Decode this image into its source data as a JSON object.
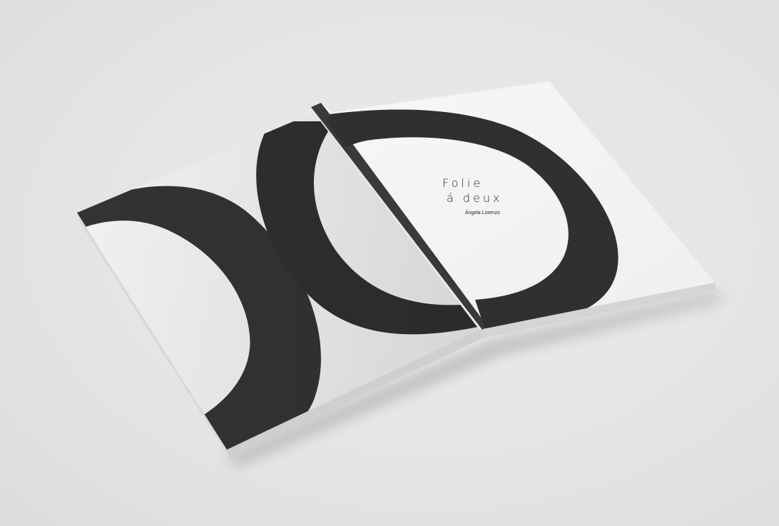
{
  "book": {
    "title_line1": "Folie",
    "title_line2": "á deux",
    "author": "Ángela Lorenzo",
    "spine_author": "Ángela Lorenzo",
    "spine_title": "Folie á deux"
  },
  "colors": {
    "background": "#e6e6e6",
    "paper": "#f4f4f4",
    "ink": "#2e2e2e",
    "spine_dark": "#3a3a3a"
  }
}
